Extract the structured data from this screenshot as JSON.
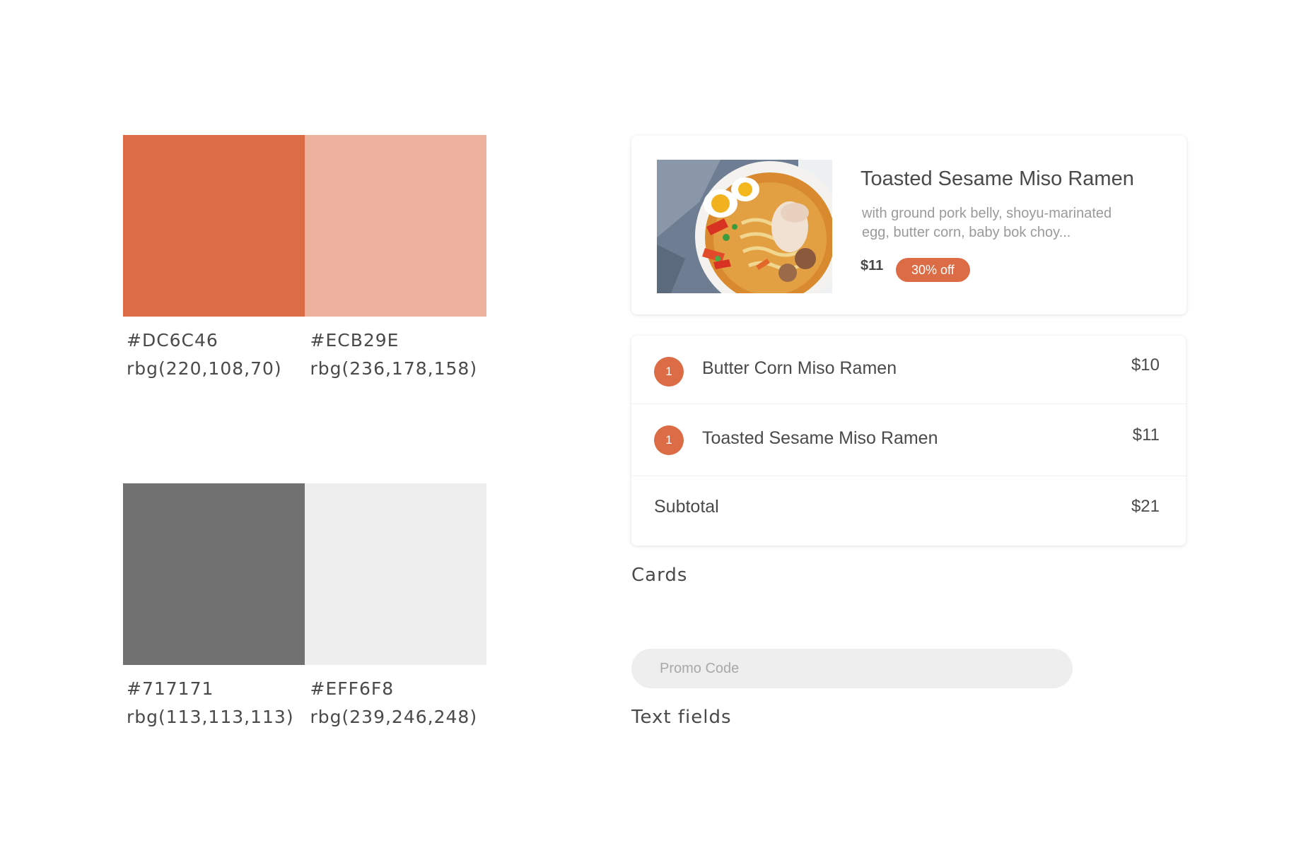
{
  "palette": {
    "primary": [
      {
        "hex": "#DC6C46",
        "rgb": "rbg(220,108,70)",
        "color": "#DC6C46"
      },
      {
        "hex": "#ECB29E",
        "rgb": "rbg(236,178,158)",
        "color": "#ECB29E"
      }
    ],
    "neutral": [
      {
        "hex": "#717171",
        "rgb": "rbg(113,113,113)",
        "color": "#717171"
      },
      {
        "hex": "#EFF6F8",
        "rgb": "rbg(239,246,248)",
        "color": "#EEEEEE"
      }
    ]
  },
  "food_card": {
    "title": "Toasted Sesame Miso Ramen",
    "description": "with ground pork belly, shoyu-marinated egg, butter corn, baby bok choy...",
    "price": "$11",
    "badge": "30% off",
    "image_icon": "ramen-bowl-photo"
  },
  "order_card": {
    "items": [
      {
        "qty": "1",
        "name": "Butter Corn Miso Ramen",
        "price": "$10"
      },
      {
        "qty": "1",
        "name": "Toasted Sesame Miso Ramen",
        "price": "$11"
      }
    ],
    "subtotal_label": "Subtotal",
    "subtotal": "$21"
  },
  "captions": {
    "cards": "Cards",
    "text_fields": "Text fields"
  },
  "promo": {
    "placeholder": "Promo Code"
  },
  "colors": {
    "accent": "#DC6C46",
    "accent_light": "#ECB29E",
    "text": "#4a4a4a",
    "field_bg": "#EEEEEE"
  }
}
